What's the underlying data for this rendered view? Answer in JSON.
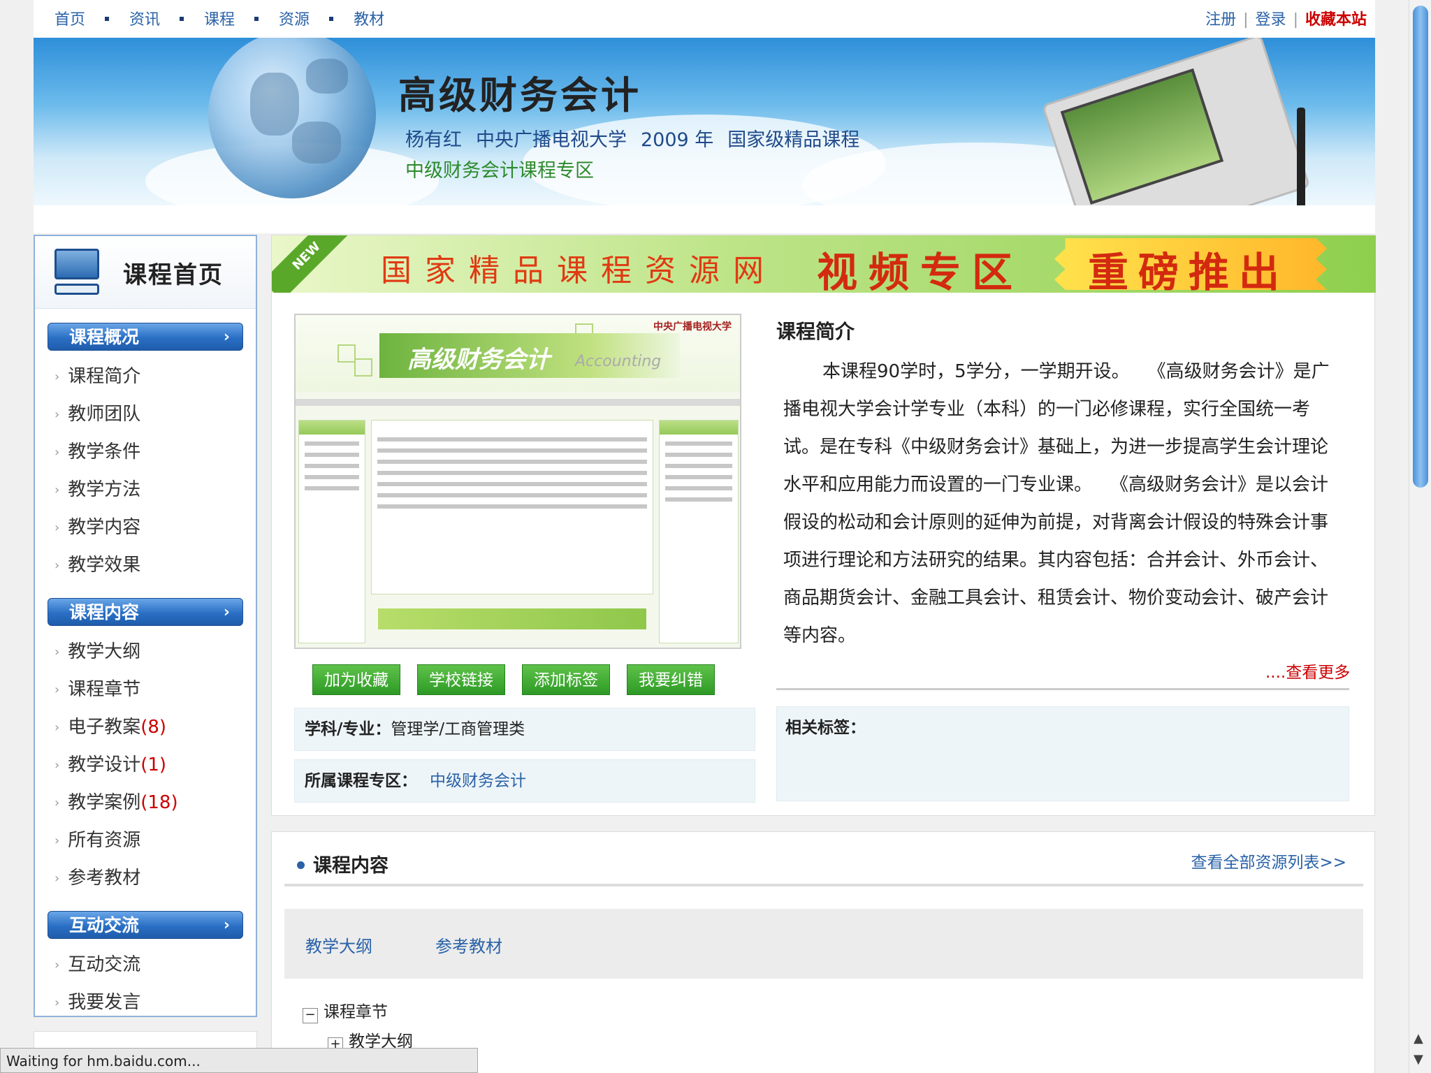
{
  "topnav": {
    "links": [
      "首页",
      "资讯",
      "课程",
      "资源",
      "教材"
    ],
    "register": "注册",
    "login": "登录",
    "favorite": "收藏本站"
  },
  "banner": {
    "title": "高级财务会计",
    "author": "杨有红",
    "school": "中央广播电视大学",
    "year": "2009 年",
    "level": "国家级精品课程",
    "zone": "中级财务会计课程专区"
  },
  "sidebar": {
    "home_title": "课程首页",
    "sections": [
      {
        "title": "课程概况",
        "items": [
          "课程简介",
          "教师团队",
          "教学条件",
          "教学方法",
          "教学内容",
          "教学效果"
        ]
      },
      {
        "title": "课程内容",
        "items": [
          "教学大纲",
          "课程章节",
          "电子教案",
          "教学设计",
          "教学案例",
          "所有资源",
          "参考教材"
        ],
        "counts": [
          "",
          "",
          "(8)",
          "(1)",
          "(18)",
          "",
          ""
        ]
      },
      {
        "title": "互动交流",
        "items": [
          "互动交流",
          "我要发言"
        ]
      }
    ]
  },
  "promo": {
    "new_badge": "NEW",
    "text1": "国家精品课程资源网",
    "text2": "视频专区",
    "text3": "重磅推出"
  },
  "thumbnail": {
    "title": "高级财务会计",
    "subtitle": "Accounting",
    "brand": "中央广播电视大学"
  },
  "buttons": {
    "add_fav": "加为收藏",
    "school_link": "学校链接",
    "add_tag": "添加标签",
    "report_error": "我要纠错"
  },
  "info": {
    "subject_label": "学科/专业：",
    "subject_value": "管理学/工商管理类",
    "zone_label": "所属课程专区：",
    "zone_value": "中级财务会计"
  },
  "intro": {
    "title": "课程简介",
    "text": "本课程90学时，5学分，一学期开设。　　《高级财务会计》是广播电视大学会计学专业（本科）的一门必修课程，实行全国统一考试。是在专科《中级财务会计》基础上，为进一步提高学生会计理论水平和应用能力而设置的一门专业课。　　《高级财务会计》是以会计假设的松动和会计原则的延伸为前提，对背离会计假设的特殊会计事项进行理论和方法研究的结果。其内容包括：合并会计、外币会计、商品期货会计、金融工具会计、租赁会计、物价变动会计、破产会计等内容。",
    "more": "....查看更多",
    "tags_label": "相关标签："
  },
  "content": {
    "title": "课程内容",
    "view_all": "查看全部资源列表>>",
    "tabs": [
      "教学大纲",
      "参考教材"
    ],
    "tree": [
      {
        "label": "课程章节",
        "state": "−"
      },
      {
        "label": "教学大纲",
        "state": "+"
      }
    ]
  },
  "status": {
    "text": "Waiting for hm.baidu.com..."
  },
  "colors": {
    "link": "#2a62a8",
    "accent_red": "#cc0000",
    "button_green": "#2d9a25",
    "section_blue": "#2a6fc4"
  }
}
